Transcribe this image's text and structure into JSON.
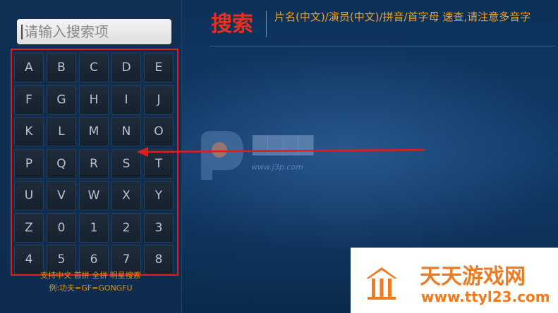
{
  "search": {
    "placeholder": "请输入搜索项"
  },
  "keyboard": {
    "keys": [
      "A",
      "B",
      "C",
      "D",
      "E",
      "F",
      "G",
      "H",
      "I",
      "J",
      "K",
      "L",
      "M",
      "N",
      "O",
      "P",
      "Q",
      "R",
      "S",
      "T",
      "U",
      "V",
      "W",
      "X",
      "Y",
      "Z",
      "0",
      "1",
      "2",
      "3",
      "4",
      "5",
      "6",
      "7",
      "8"
    ]
  },
  "hint": {
    "line1": "支持中文 首拼 全拼 明星搜索",
    "line2": "例:功夫=GF=GONGFU"
  },
  "header": {
    "title": "搜索",
    "description": "片名(中文)/演员(中文)/拼音/首字母 速查,请注意多音字"
  },
  "watermark_center": {
    "url": "www.j3p.com"
  },
  "watermark_corner": {
    "title": "天天游戏网",
    "url": "www.ttyl23.com"
  },
  "colors": {
    "accent_red": "#e31b1b",
    "hint_orange": "#e2901e",
    "title_red": "#e8301f",
    "corner_orange": "#f07a1f"
  }
}
